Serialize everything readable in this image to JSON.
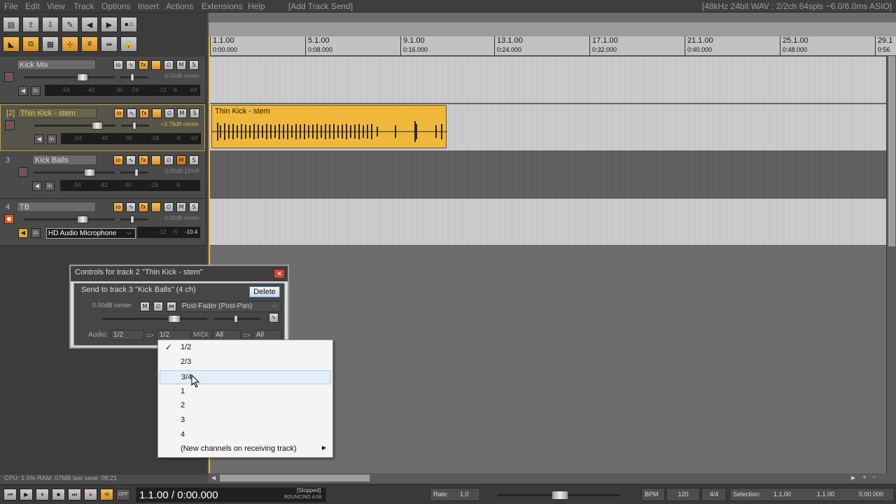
{
  "menubar": {
    "items": [
      "File",
      "Edit",
      "View",
      "Track",
      "Options",
      "Insert",
      "Actions",
      "Extensions",
      "Help"
    ],
    "undo": "[Add Track Send]",
    "audio_status": "[48kHz 24bit WAV : 2/2ch 64spls ~6.0/6.0ms ASIO]"
  },
  "tracks": [
    {
      "num": "",
      "name": "Kick Mix",
      "vol": "0.00dB center",
      "scale": [
        "-54",
        "-42",
        "-30",
        "-24",
        "-12",
        "-6",
        "-inf"
      ]
    },
    {
      "num": "[2]",
      "name": "Thin Kick - stem",
      "vol": "+3.79dB center",
      "scale": [
        "-54",
        "-42",
        "-30",
        "-18",
        "-6",
        "-inf"
      ]
    },
    {
      "num": "3",
      "name": "Kick Balls",
      "vol": "0.00dB 12%R",
      "scale": [
        "-54",
        "-42",
        "-30",
        "-18",
        "-6"
      ]
    },
    {
      "num": "4",
      "name": "TB",
      "vol": "0.00dB center",
      "input": "HD Audio Microphone",
      "scale": [
        "-12",
        "-6",
        "-10.4"
      ]
    }
  ],
  "ruler": [
    {
      "bar": "1.1.00",
      "time": "0:00.000"
    },
    {
      "bar": "5.1.00",
      "time": "0:08.000"
    },
    {
      "bar": "9.1.00",
      "time": "0:16.000"
    },
    {
      "bar": "13.1.00",
      "time": "0:24.000"
    },
    {
      "bar": "17.1.00",
      "time": "0:32.000"
    },
    {
      "bar": "21.1.00",
      "time": "0:40.000"
    },
    {
      "bar": "25.1.00",
      "time": "0:48.000"
    },
    {
      "bar": "29.1",
      "time": "0:56"
    }
  ],
  "item": {
    "title": "Thin Kick - stem"
  },
  "dialog": {
    "title": "Controls for track 2 \"Thin Kick - stem\"",
    "send_label": "Send to track 3 \"Kick Balls\" (4 ch)",
    "delete": "Delete",
    "vol": "0.00dB center",
    "mode": "Post-Fader (Post-Pan)",
    "audio_label": "Audio:",
    "audio_src": "1/2",
    "arrow": "=>",
    "audio_dst": "1/2",
    "midi_label": "MIDI:",
    "midi_src": "All",
    "midi_dst": "All"
  },
  "dropdown": {
    "items": [
      "1/2",
      "2/3",
      "3/4",
      "1",
      "2",
      "3",
      "4",
      "(New channels on receiving track)"
    ],
    "checked": "1/2",
    "highlighted": "3/4"
  },
  "status": {
    "cpu": "CPU: 1.5%  RAM: 67MB  last save: 08:21"
  },
  "transport": {
    "position": "1.1.00 / 0:00.000",
    "state": "[Stopped]",
    "state2": "BOUNCING 4:08",
    "off": "OFF",
    "rate_label": "Rate:",
    "rate": "1.0",
    "bpm_label": "BPM",
    "bpm": "120",
    "sig": "4/4",
    "sel_label": "Selection:",
    "sel_start": "1.1.00",
    "sel_end": "1.1.00",
    "sel_len": "0.00.000"
  },
  "colors": {
    "accent": "#f0b83a",
    "record": "#e8571f"
  }
}
